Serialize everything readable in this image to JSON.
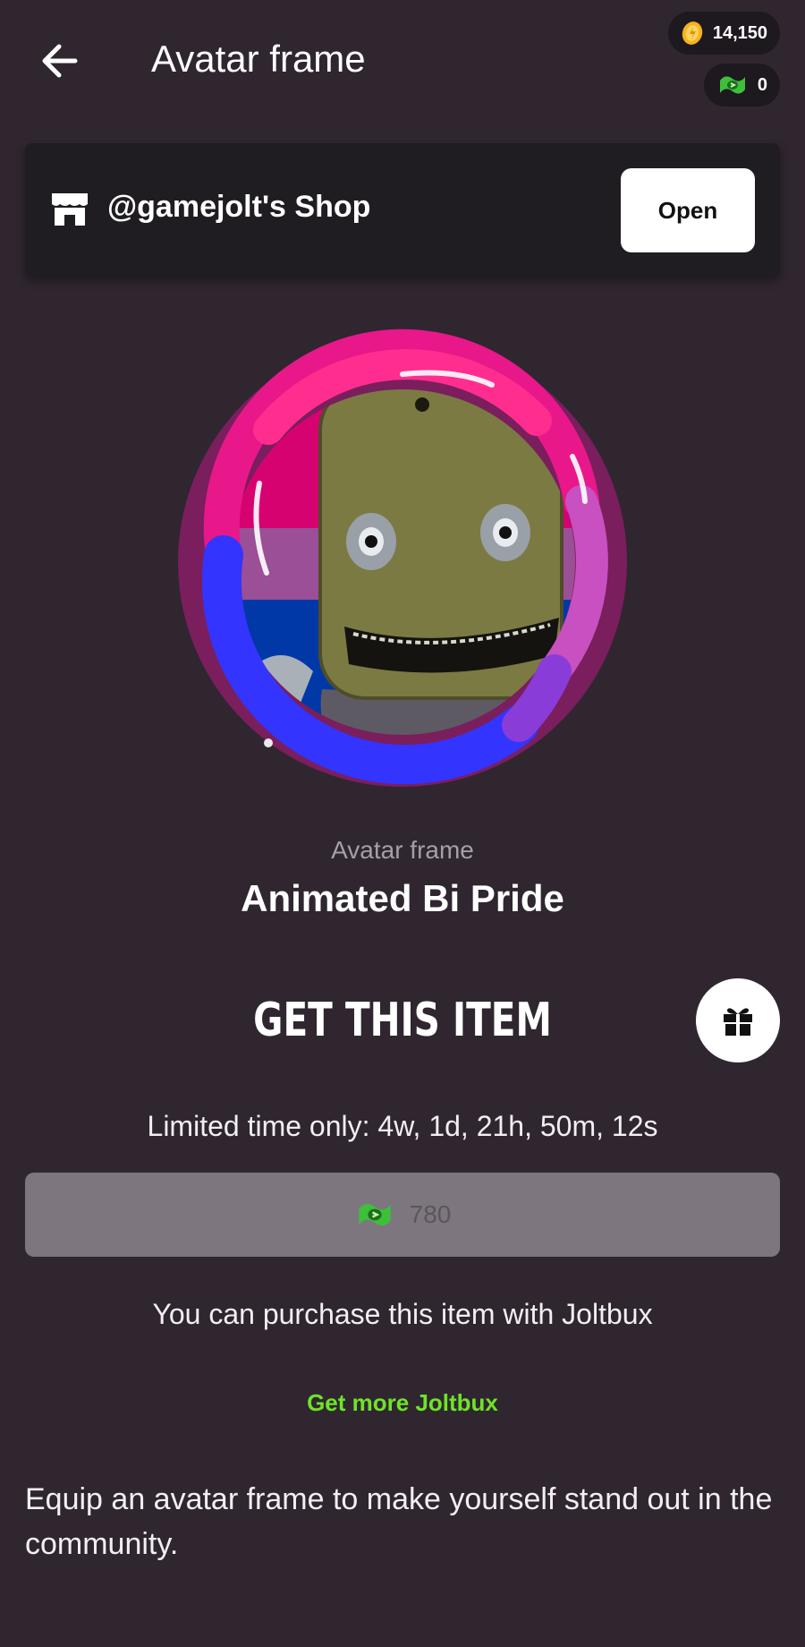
{
  "header": {
    "title": "Avatar frame",
    "back_icon": "arrow-left-icon",
    "coins": "14,150",
    "joltbux": "0"
  },
  "shop": {
    "name": "@gamejolt's Shop",
    "open_label": "Open",
    "icon": "store-icon"
  },
  "item": {
    "type_label": "Avatar frame",
    "name": "Animated Bi Pride",
    "flag_colors": [
      "#d60270",
      "#9b4f96",
      "#0038a8"
    ]
  },
  "purchase": {
    "heading": "GET THIS ITEM",
    "gift_icon": "gift-icon",
    "timer_text": "Limited time only: 4w, 1d, 21h, 50m, 12s",
    "price": "780",
    "note": "You can purchase this item with Joltbux",
    "get_more_label": "Get more Joltbux",
    "accent_color": "#6ee426"
  },
  "description": "Equip an avatar frame to make yourself stand out in the community."
}
